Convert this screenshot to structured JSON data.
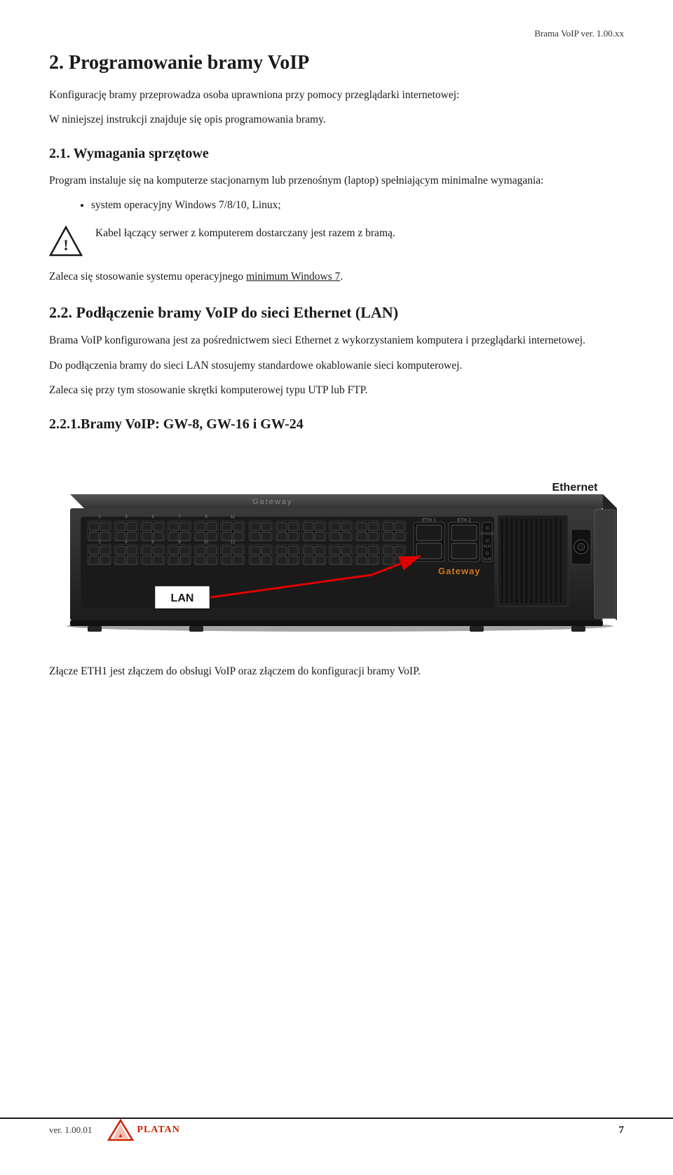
{
  "header": {
    "title": "Brama VoIP ver. 1.00.xx"
  },
  "section2": {
    "title": "2. Programowanie bramy VoIP",
    "intro1": "Konfigurację bramy przeprowadza osoba uprawniona przy pomocy przeglądarki internetowej:",
    "intro2": "W niniejszej instrukcji znajduje się opis programowania bramy.",
    "subsection1": {
      "title": "2.1. Wymagania sprzętowe",
      "body1": "Program instaluje się na komputerze stacjonarnym lub przenośnym (laptop) spełniającym minimalne wymagania:",
      "bullet1": "system operacyjny Windows 7/8/10, Linux;",
      "warning_text": "Kabel łączący serwer z komputerem dostarczany jest razem z bramą.",
      "recommend": "Zaleca się stosowanie systemu operacyjnego minimum Windows 7."
    },
    "subsection2": {
      "title": "2.2. Podłączenie bramy VoIP do sieci Ethernet (LAN)",
      "body1": "Brama VoIP konfigurowana jest za pośrednictwem sieci Ethernet z wykorzystaniem komputera i przeglądarki internetowej.",
      "body2": "Do podłączenia bramy do sieci LAN stosujemy standardowe okablowanie sieci komputerowej.",
      "body3": "Zaleca się przy tym stosowanie skrętki komputerowej typu UTP lub FTP."
    },
    "subsection3": {
      "title": "2.2.1.Bramy VoIP: GW-8, GW-16 i GW-24"
    },
    "lan_label": "LAN",
    "ethernet_label": "Ethernet",
    "caption": "Złącze ETH1 jest złączem do obsługi VoIP oraz złączem do konfiguracji bramy VoIP."
  },
  "footer": {
    "version": "ver. 1.00.01",
    "page_number": "7",
    "logo_text": "PLATAN"
  }
}
